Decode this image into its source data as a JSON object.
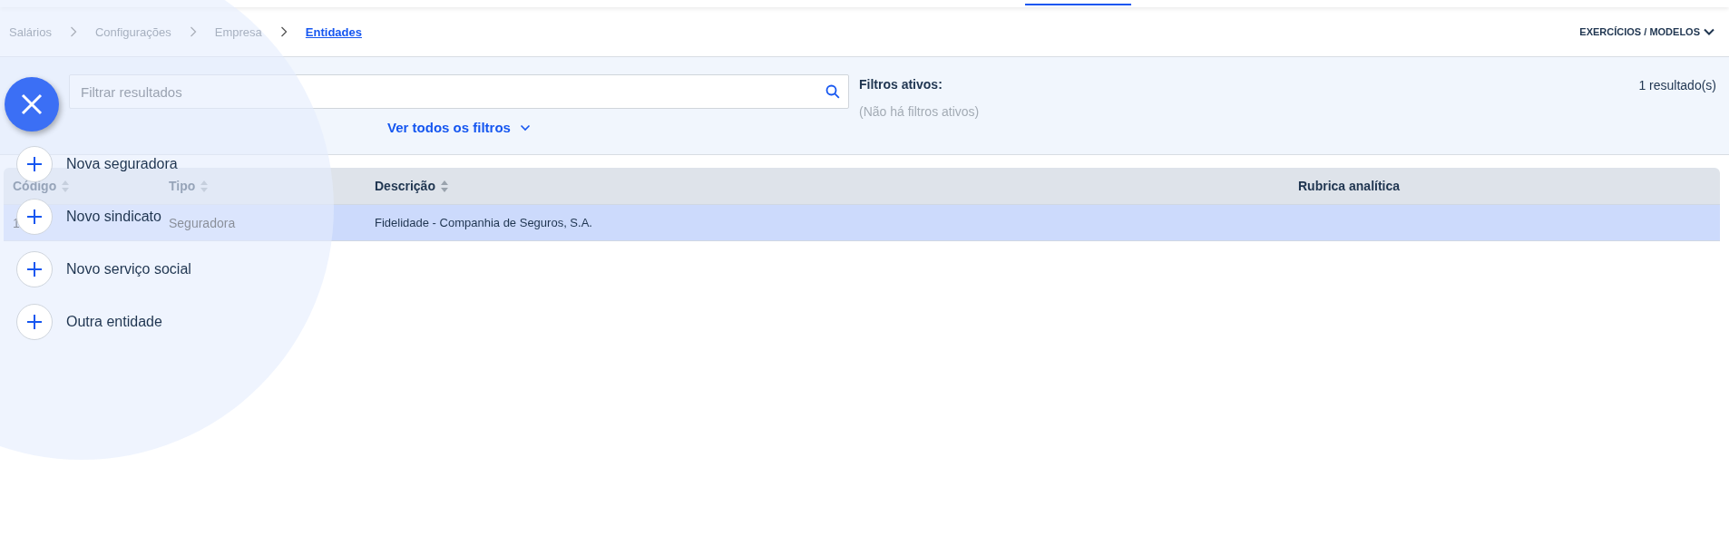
{
  "breadcrumb": [
    {
      "label": "Salários",
      "selected": false
    },
    {
      "label": "Configurações",
      "selected": false
    },
    {
      "label": "Empresa",
      "selected": false
    },
    {
      "label": "Entidades",
      "selected": true
    }
  ],
  "header_menu": {
    "label": "EXERCÍCIOS / MODELOS"
  },
  "search": {
    "placeholder": "Filtrar resultados"
  },
  "filters_link": "Ver todos os filtros",
  "active_filters": {
    "title": "Filtros ativos:",
    "empty": "(Não há filtros ativos)"
  },
  "result_count": "1 resultado(s)",
  "table": {
    "columns": [
      {
        "label": "Código",
        "sortable": true
      },
      {
        "label": "Tipo",
        "sortable": true
      },
      {
        "label": "Descrição",
        "sortable": true
      },
      {
        "label": "Rubrica analítica",
        "sortable": false
      }
    ],
    "rows": [
      {
        "cells": [
          "1",
          "Seguradora",
          "Fidelidade - Companhia de Seguros, S.A."
        ],
        "selected": true
      }
    ]
  },
  "fab_menu": {
    "open": true,
    "items": [
      {
        "label": "Nova seguradora"
      },
      {
        "label": "Novo sindicato"
      },
      {
        "label": "Novo serviço social"
      },
      {
        "label": "Outra entidade"
      }
    ]
  }
}
